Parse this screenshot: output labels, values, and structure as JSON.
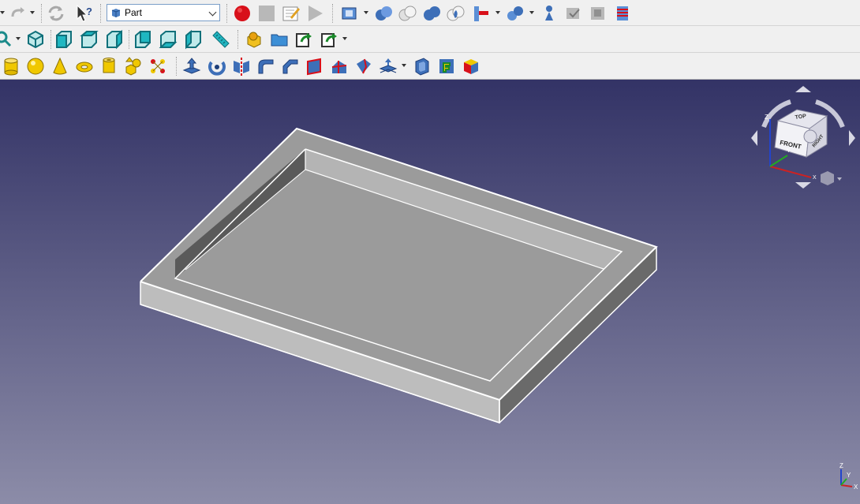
{
  "toolbar_top": {
    "workbench_selector": {
      "selected": "Part",
      "icon": "part-workbench-icon"
    },
    "icons": [
      "redo-icon",
      "refresh-icon",
      "whats-this-icon",
      "macro-record-icon",
      "macro-stop-icon",
      "macro-edit-icon",
      "macro-run-icon",
      "view-std-icon",
      "boolean-icon",
      "cut-icon",
      "fuse-icon",
      "common-icon",
      "section-icon",
      "join-icon",
      "compound-icon",
      "shape-builder-icon",
      "check-geometry-icon",
      "defeaturing-icon"
    ]
  },
  "toolbar_views": {
    "icons": [
      "zoom-icon",
      "view-isometric-icon",
      "view-front-icon",
      "view-top-icon",
      "view-right-icon",
      "view-rear-icon",
      "view-bottom-icon",
      "view-left-icon",
      "measure-icon",
      "part-icon",
      "group-icon",
      "link-icon",
      "link-actions-icon"
    ]
  },
  "toolbar_part": {
    "icons": [
      "cylinder-icon",
      "sphere-icon",
      "cone-icon",
      "torus-icon",
      "tube-icon",
      "primitives-icon",
      "shape-builder-icon",
      "extrude-icon",
      "revolve-icon",
      "mirror-icon",
      "fillet-icon",
      "chamfer-icon",
      "make-face-icon",
      "ruled-surface-icon",
      "loft-icon",
      "offset-icon",
      "thickness-icon",
      "projection-icon",
      "attachment-icon",
      "color-per-face-icon"
    ]
  },
  "navigation_cube": {
    "faces": {
      "top": "TOP",
      "front": "FRONT",
      "right": "RIGHT"
    },
    "axes": {
      "x": "X",
      "y": "Y",
      "z": "Z"
    }
  },
  "axis_indicator": {
    "x": "X",
    "y": "Y",
    "z": "Z"
  },
  "colors": {
    "viewport_top": "#333366",
    "viewport_bottom": "#8c8ca8",
    "model_top_face": "#9b9b9b",
    "model_inner_face": "#5a5a5a",
    "model_outer_face": "#bdbdbd",
    "axis_x": "#cc2222",
    "axis_y": "#22aa22",
    "axis_z": "#2244cc"
  }
}
